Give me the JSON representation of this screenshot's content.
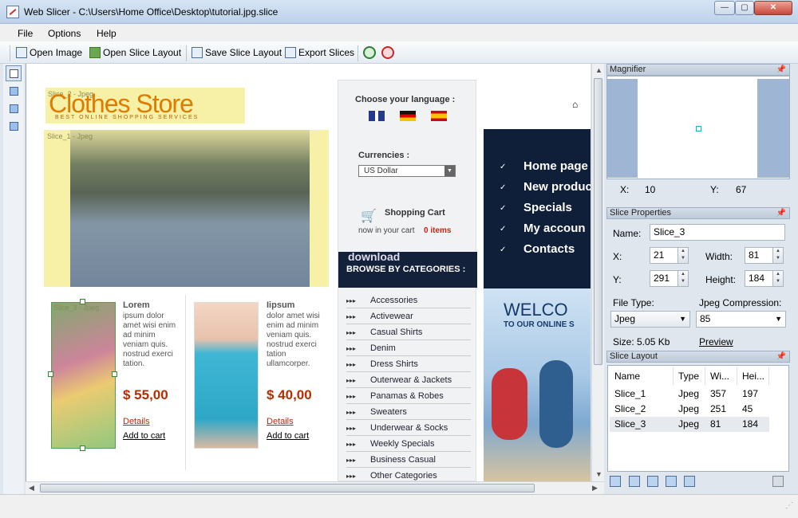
{
  "window": {
    "title": "Web Slicer - C:\\Users\\Home Office\\Desktop\\tutorial.jpg.slice"
  },
  "menu": [
    "File",
    "Options",
    "Help"
  ],
  "toolbar": {
    "open_image": "Open Image",
    "open_layout": "Open Slice Layout",
    "save_layout": "Save Slice Layout",
    "export": "Export Slices"
  },
  "canvas": {
    "logo_main": "Clothes Store",
    "logo_sub": "BEST ONLINE SHOPPING SERVICES",
    "slice1_label": "Slice_1 - Jpeg",
    "slice2_label": "Slice_2 - Jpeg",
    "slice3_label": "Slice_3 - Jpeg",
    "products": [
      {
        "title": "Lorem",
        "desc": "ipsum dolor amet wisi enim ad minim veniam quis. nostrud exerci tation.",
        "price": "$ 55,00",
        "details": "Details",
        "cart": "Add to cart"
      },
      {
        "title": "Iipsum",
        "desc": "dolor amet wisi enim ad minim veniam quis. nostrud exerci tation ullamcorper.",
        "price": "$ 40,00",
        "details": "Details",
        "cart": "Add to cart"
      }
    ],
    "choose_language": "Choose your language :",
    "currencies": "Currencies :",
    "currency_value": "US Dollar",
    "shopping_cart": "Shopping Cart",
    "cart_text": "now in your cart",
    "cart_items": "0 items",
    "watermark": "download",
    "browse": "BROWSE BY CATEGORIES :",
    "categories": [
      "Accessories",
      "Activewear",
      "Casual Shirts",
      "Denim",
      "Dress Shirts",
      "Outerwear & Jackets",
      "Panamas & Robes",
      "Sweaters",
      "Underwear & Socks",
      "Weekly Specials",
      "Business Casual",
      "Other Categories"
    ],
    "nav": [
      "Home page",
      "New produc",
      "Specials",
      "My accoun",
      "Contacts"
    ],
    "welcome": "WELCO",
    "welcome_sub": "TO OUR ONLINE S"
  },
  "magnifier": {
    "title": "Magnifier",
    "x_label": "X:",
    "x": "10",
    "y_label": "Y:",
    "y": "67"
  },
  "props": {
    "title": "Slice Properties",
    "name_label": "Name:",
    "name": "Slice_3",
    "x_label": "X:",
    "x": "21",
    "width_label": "Width:",
    "width": "81",
    "y_label": "Y:",
    "y": "291",
    "height_label": "Height:",
    "height": "184",
    "filetype_label": "File Type:",
    "filetype": "Jpeg",
    "jpeg_label": "Jpeg Compression:",
    "jpeg": "85",
    "size": "Size: 5.05 Kb",
    "preview": "Preview"
  },
  "layout": {
    "title": "Slice Layout",
    "headers": [
      "Name",
      "Type",
      "Wi...",
      "Hei..."
    ],
    "rows": [
      {
        "name": "Slice_1",
        "type": "Jpeg",
        "w": "357",
        "h": "197"
      },
      {
        "name": "Slice_2",
        "type": "Jpeg",
        "w": "251",
        "h": "45"
      },
      {
        "name": "Slice_3",
        "type": "Jpeg",
        "w": "81",
        "h": "184"
      }
    ]
  },
  "colors": {
    "accent": "#b32f00",
    "nav_bg": "#0f1f3a",
    "slice_yellow": "#f7f1a8",
    "slice_green": "#7fbf6a"
  }
}
